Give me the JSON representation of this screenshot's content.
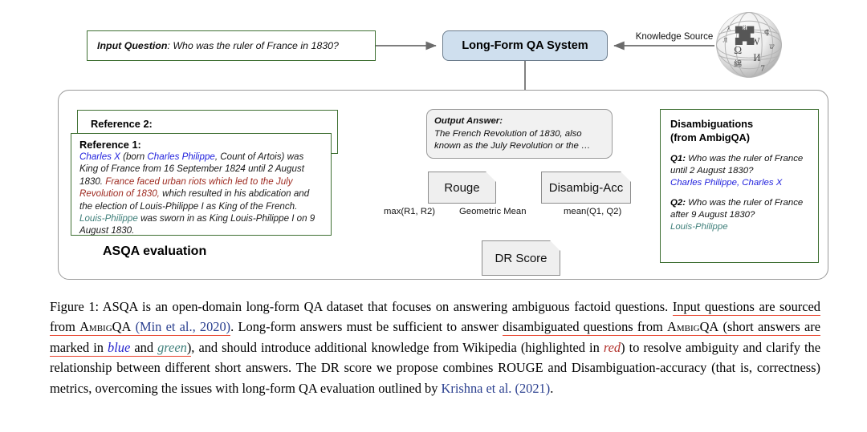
{
  "figure": {
    "input_question": {
      "label": "Input Question",
      "separator": ": ",
      "text": "Who was the ruler of France in 1830?"
    },
    "qa_system": {
      "label": "Long-Form QA System"
    },
    "knowledge_source": {
      "label": "Knowledge Source",
      "icon": "wikipedia-globe-icon"
    },
    "container": {
      "label": "ASQA evaluation"
    },
    "reference2": {
      "title": "Reference 2:"
    },
    "reference1": {
      "title": "Reference 1:",
      "segments": [
        {
          "text": "Charles X",
          "color": "blue"
        },
        {
          "text": " (born ",
          "color": "black"
        },
        {
          "text": "Charles Philippe",
          "color": "blue"
        },
        {
          "text": ", Count of Artois) was King of France from 16 September 1824 until 2 August 1830. ",
          "color": "black"
        },
        {
          "text": "France faced urban riots which led to the July Revolution of 1830,",
          "color": "red"
        },
        {
          "text": " which resulted in his abdication and the election of Louis-Philippe I as King of the French. ",
          "color": "black"
        },
        {
          "text": "Louis-Philippe",
          "color": "green"
        },
        {
          "text": " was sworn in as King Louis-Philippe I on 9 August 1830.",
          "color": "black"
        }
      ]
    },
    "output_answer": {
      "title": "Output Answer:",
      "text": "The French Revolution of 1830, also known as the July Revolution or the …"
    },
    "nodes": {
      "rouge": "Rouge",
      "disambig_acc": "Disambig-Acc",
      "dr_score": "DR Score"
    },
    "edge_labels": {
      "max": "max(R1, R2)",
      "geometric_mean": "Geometric Mean",
      "mean": "mean(Q1, Q2)"
    },
    "disambiguations": {
      "title_line1": "Disambiguations",
      "title_line2": "(from AmbigQA)",
      "items": [
        {
          "label": "Q1:",
          "question": " Who was the ruler of France until 2 August 1830?",
          "answer": "Charles Philippe, Charles X",
          "answer_color": "blue"
        },
        {
          "label": "Q2:",
          "question": " Who was the ruler of France after 9 August 1830?",
          "answer": "Louis-Philippe",
          "answer_color": "green"
        }
      ]
    },
    "colors": {
      "blue": "#2222dd",
      "red": "#9e2a20",
      "green": "#3f7f7a",
      "green_border": "#3f7033",
      "system_fill": "#cfdfee",
      "node_fill": "#efefef",
      "underline_red": "#e8402a",
      "citation_blue": "#2a3f8f"
    }
  },
  "caption": {
    "prefix": "Figure 1:",
    "runs": [
      {
        "t": " ASQA is an open-domain long-form QA dataset that focuses on answering ambiguous factoid questions. ",
        "style": "plain"
      },
      {
        "t": "Input questions are sourced from ",
        "style": "underline"
      },
      {
        "t": "AmbigQA",
        "style": "underline-smallcaps"
      },
      {
        "t": " ",
        "style": "underline"
      },
      {
        "t": "(Min et al., 2020)",
        "style": "underline-cite"
      },
      {
        "t": ". Long-form answers must be sufficient to answer ",
        "style": "plain"
      },
      {
        "t": "disambiguated questions from ",
        "style": "underline"
      },
      {
        "t": "AmbigQA",
        "style": "underline-smallcaps"
      },
      {
        "t": " (short answers are marked in ",
        "style": "underline"
      },
      {
        "t": "blue",
        "style": "underline-blue"
      },
      {
        "t": " and ",
        "style": "underline"
      },
      {
        "t": "green",
        "style": "underline-green"
      },
      {
        "t": ")",
        "style": "underline"
      },
      {
        "t": ", and should introduce additional knowledge from Wikipedia (highlighted in ",
        "style": "plain"
      },
      {
        "t": "red",
        "style": "red"
      },
      {
        "t": ") to resolve ambiguity and clarify the relationship between different short answers. The DR score we propose combines ROUGE and Disambiguation-accuracy (that is, correctness) metrics, overcoming the issues with long-form QA evaluation outlined by ",
        "style": "plain"
      },
      {
        "t": "Krishna et al.",
        "style": "cite"
      },
      {
        "t": " ",
        "style": "plain"
      },
      {
        "t": "(2021)",
        "style": "cite"
      },
      {
        "t": ".",
        "style": "plain"
      }
    ]
  }
}
